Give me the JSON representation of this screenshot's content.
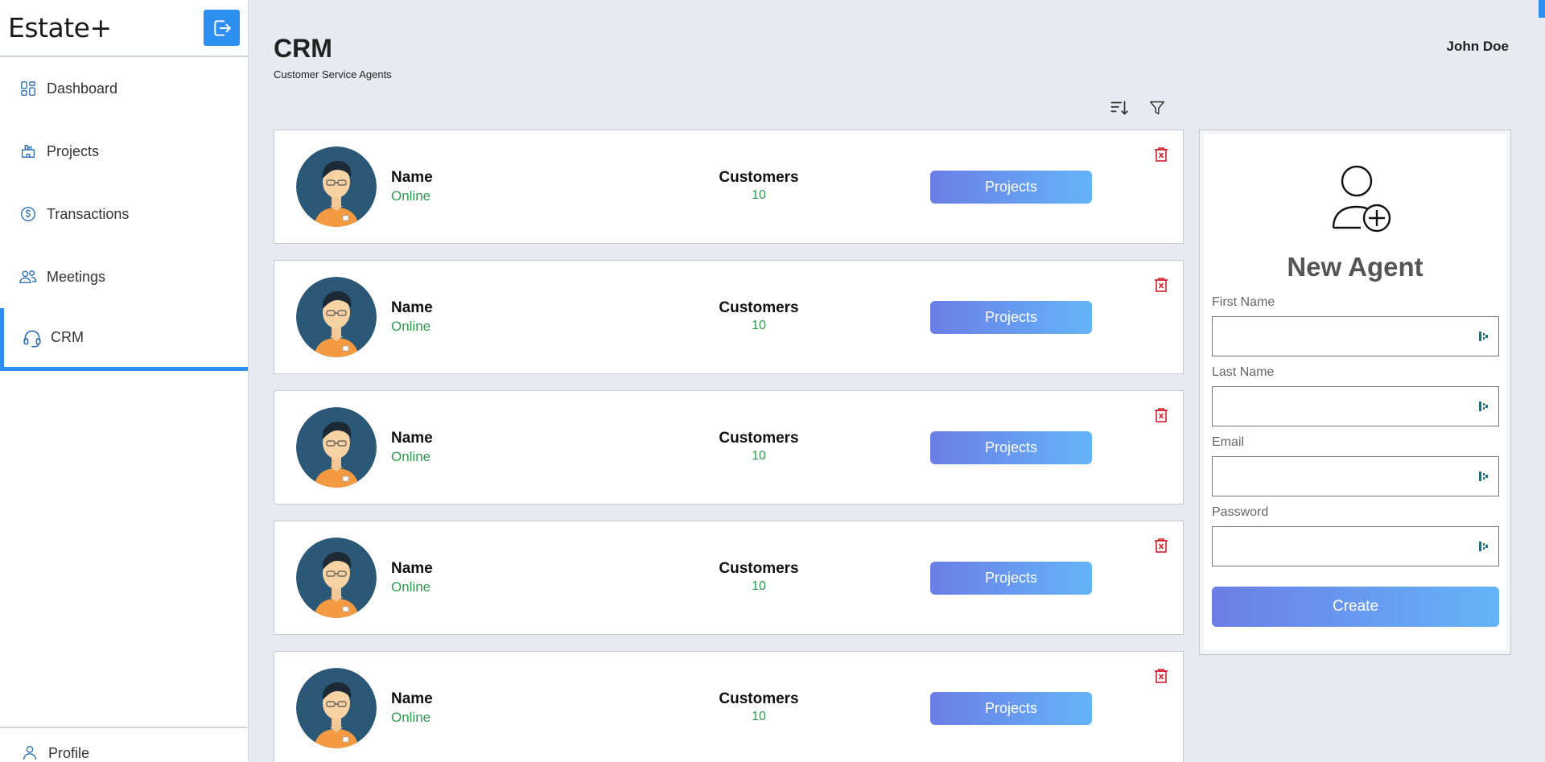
{
  "app": {
    "brand": "Estate+"
  },
  "sidebar": {
    "items": [
      {
        "label": "Dashboard",
        "icon": "dashboard-icon"
      },
      {
        "label": "Projects",
        "icon": "projects-icon"
      },
      {
        "label": "Transactions",
        "icon": "dollar-icon"
      },
      {
        "label": "Meetings",
        "icon": "people-icon"
      },
      {
        "label": "CRM",
        "icon": "headset-icon",
        "active": true
      }
    ],
    "profile": {
      "label": "Profile",
      "icon": "user-icon"
    }
  },
  "header": {
    "title": "CRM",
    "subtitle": "Customer Service Agents",
    "user": "John Doe"
  },
  "toolbar": {
    "sort_icon": "sort-icon",
    "filter_icon": "filter-icon"
  },
  "agents": [
    {
      "name": "Name",
      "status": "Online",
      "customers_label": "Customers",
      "customers": "10",
      "button": "Projects"
    },
    {
      "name": "Name",
      "status": "Online",
      "customers_label": "Customers",
      "customers": "10",
      "button": "Projects"
    },
    {
      "name": "Name",
      "status": "Online",
      "customers_label": "Customers",
      "customers": "10",
      "button": "Projects"
    },
    {
      "name": "Name",
      "status": "Online",
      "customers_label": "Customers",
      "customers": "10",
      "button": "Projects"
    },
    {
      "name": "Name",
      "status": "Online",
      "customers_label": "Customers",
      "customers": "10",
      "button": "Projects"
    }
  ],
  "new_agent": {
    "title": "New Agent",
    "fields": [
      {
        "label": "First Name",
        "value": ""
      },
      {
        "label": "Last Name",
        "value": ""
      },
      {
        "label": "Email",
        "value": ""
      },
      {
        "label": "Password",
        "value": ""
      }
    ],
    "create_label": "Create"
  },
  "colors": {
    "accent": "#2d8ff0",
    "status_online": "#2e9a4f",
    "delete": "#d11f2a",
    "button_gradient_start": "#6b7ee6",
    "button_gradient_end": "#64b4f8"
  }
}
